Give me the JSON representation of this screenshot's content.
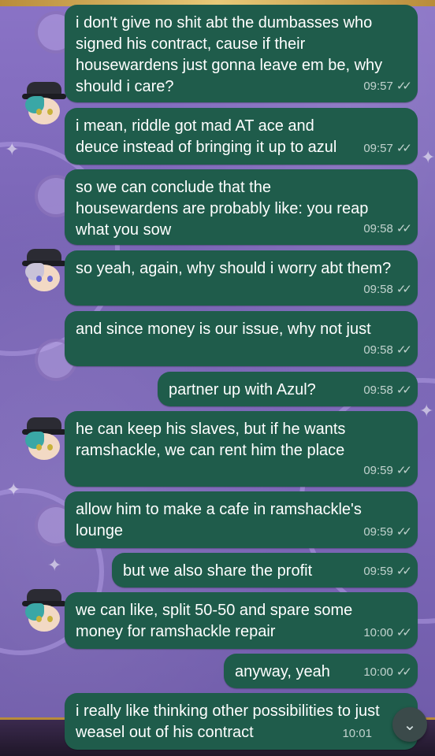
{
  "messages": [
    {
      "text": "i don't give no shit abt the dumbasses who signed his contract, cause if their housewardens just gonna leave em be, why should i care?",
      "time": "09:57"
    },
    {
      "text": "i mean, riddle got mad AT ace and deuce instead of bringing it up to azul",
      "time": "09:57"
    },
    {
      "text": "so we can conclude that the housewardens are probably like: you reap what you sow",
      "time": "09:58"
    },
    {
      "text": "so yeah, again, why should i worry abt them?",
      "time": "09:58"
    },
    {
      "text": "and since money is our issue, why not just",
      "time": "09:58"
    },
    {
      "text": "partner up with Azul?",
      "time": "09:58"
    },
    {
      "text": "he can keep his slaves, but if he wants ramshackle, we can rent him the place",
      "time": "09:59"
    },
    {
      "text": "allow him to make a cafe in ramshackle's lounge",
      "time": "09:59"
    },
    {
      "text": "but we also share the profit",
      "time": "09:59"
    },
    {
      "text": "we can like, split 50-50 and spare some money for ramshackle repair",
      "time": "10:00"
    },
    {
      "text": "anyway, yeah",
      "time": "10:00"
    },
    {
      "text": "i really like thinking other possibilities to just weasel out of his contract",
      "time": "10:01"
    }
  ],
  "read_status_icon": "double-check-icon",
  "scroll_button_icon": "chevron-double-down-icon",
  "colors": {
    "bubble": "#1f5c4b",
    "wallpaper": "#7a64b8"
  }
}
